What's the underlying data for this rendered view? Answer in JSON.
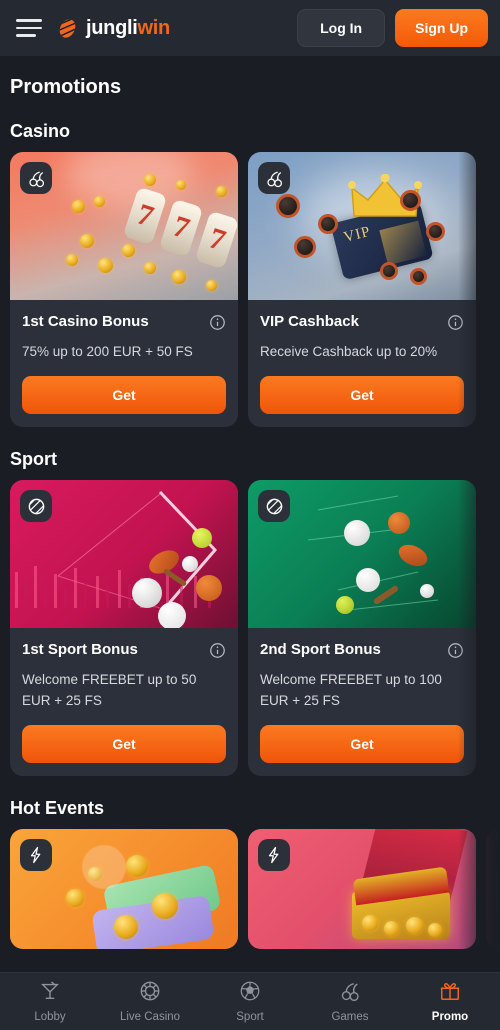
{
  "header": {
    "menu_icon": "hamburger-icon",
    "logo_primary": "jungli",
    "logo_accent": "win",
    "login_label": "Log In",
    "signup_label": "Sign Up",
    "accent_color": "#f2661a",
    "bg_color": "#252a32"
  },
  "page": {
    "title": "Promotions",
    "bg_color": "#1a1e24"
  },
  "sections": [
    {
      "title": "Casino",
      "cards": [
        {
          "badge_icon": "cherries-icon",
          "title": "1st Casino Bonus",
          "desc": "75% up to 200 EUR + 50 FS",
          "info_icon": "info-icon",
          "cta": "Get",
          "art": "slot-machine-777"
        },
        {
          "badge_icon": "cherries-icon",
          "title": "VIP Cashback",
          "desc": "Receive Cashback up to 20%",
          "info_icon": "info-icon",
          "cta": "Get",
          "art": "vip-crown-card"
        }
      ]
    },
    {
      "title": "Sport",
      "cards": [
        {
          "badge_icon": "striped-ball-icon",
          "title": "1st Sport Bonus",
          "desc": "Welcome FREEBET up to 50 EUR + 25 FS",
          "info_icon": "info-icon",
          "cta": "Get",
          "art": "sport-balls-pink"
        },
        {
          "badge_icon": "striped-ball-icon",
          "title": "2nd Sport Bonus",
          "desc": "Welcome FREEBET up to 100 EUR + 25 FS",
          "info_icon": "info-icon",
          "cta": "Get",
          "art": "sport-balls-green"
        }
      ]
    },
    {
      "title": "Hot Events",
      "cards": [
        {
          "badge_icon": "lightning-bolt-icon",
          "art": "money-coins-orange"
        },
        {
          "badge_icon": "lightning-bolt-icon",
          "art": "treasure-chest-pink"
        },
        {
          "badge_icon": "lightning-bolt-icon",
          "art": "peek-card-dark"
        }
      ]
    }
  ],
  "bottom_nav": {
    "items": [
      {
        "label": "Lobby",
        "icon": "cocktail-glass-icon",
        "active": false
      },
      {
        "label": "Live Casino",
        "icon": "casino-chip-icon",
        "active": false
      },
      {
        "label": "Sport",
        "icon": "soccer-ball-icon",
        "active": false
      },
      {
        "label": "Games",
        "icon": "cherries-icon",
        "active": false
      },
      {
        "label": "Promo",
        "icon": "gift-box-icon",
        "active": true
      }
    ],
    "active_color": "#f2661a",
    "inactive_color": "#8e949d"
  }
}
